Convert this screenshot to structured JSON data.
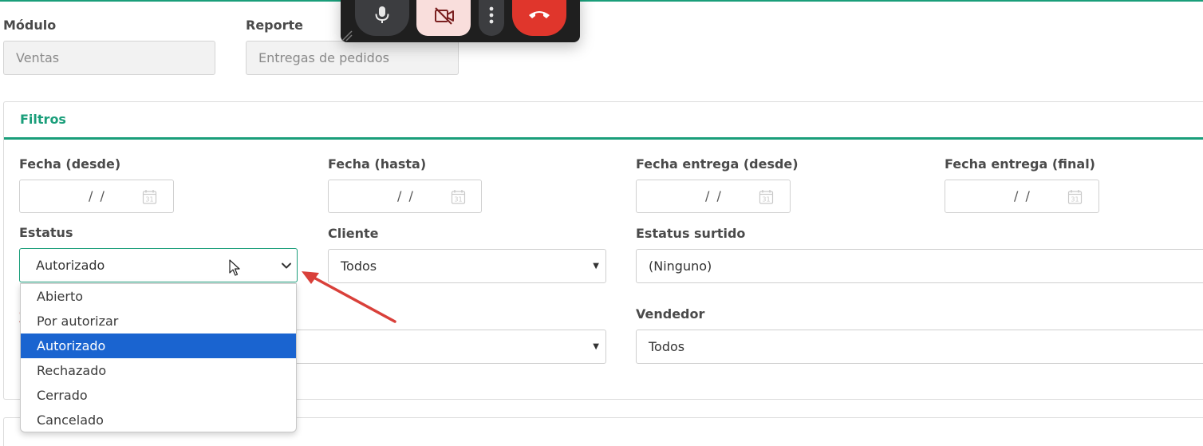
{
  "header": {
    "modulo_label": "Módulo",
    "modulo_value": "Ventas",
    "reporte_label": "Reporte",
    "reporte_value": "Entregas de pedidos"
  },
  "filters": {
    "title": "Filtros",
    "fecha_desde_label": "Fecha (desde)",
    "fecha_hasta_label": "Fecha (hasta)",
    "fecha_entrega_desde_label": "Fecha entrega (desde)",
    "fecha_entrega_final_label": "Fecha entrega (final)",
    "date_placeholder": "/  /",
    "estatus_label": "Estatus",
    "estatus_value": "Autorizado",
    "cliente_label": "Cliente",
    "cliente_value": "Todos",
    "estatus_surtido_label": "Estatus surtido",
    "estatus_surtido_value": "(Ninguno)",
    "vendedor_label": "Vendedor",
    "vendedor_value": "Todos"
  },
  "estatus_options": [
    "Abierto",
    "Por autorizar",
    "Autorizado",
    "Rechazado",
    "Cerrado",
    "Cancelado"
  ],
  "estatus_selected_index": 2,
  "call_controls": {
    "icons": [
      "microphone-icon",
      "camera-off-icon",
      "more-vertical-icon",
      "end-call-icon"
    ]
  },
  "colors": {
    "accent": "#1a9e7a",
    "selected_option": "#1a64d0",
    "end_call": "#e0362c",
    "annotation_arrow": "#d9403a"
  }
}
